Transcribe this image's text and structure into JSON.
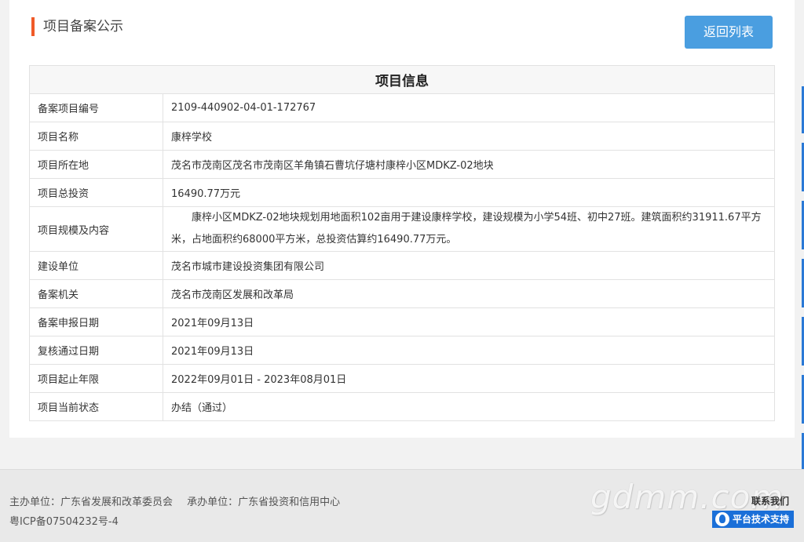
{
  "header": {
    "title": "项目备案公示",
    "back_label": "返回列表"
  },
  "table": {
    "title": "项目信息",
    "rows": [
      {
        "label": "备案项目编号",
        "value": "2109-440902-04-01-172767"
      },
      {
        "label": "项目名称",
        "value": "康梓学校"
      },
      {
        "label": "项目所在地",
        "value": "茂名市茂南区茂名市茂南区羊角镇石曹坑仔塘村康梓小区MDKZ-02地块"
      },
      {
        "label": "项目总投资",
        "value": "16490.77万元"
      },
      {
        "label": "项目规模及内容",
        "value": "康梓小区MDKZ-02地块规划用地面积102亩用于建设康梓学校，建设规模为小学54班、初中27班。建筑面积约31911.67平方米，占地面积约68000平方米，总投资估算约16490.77万元。"
      },
      {
        "label": "建设单位",
        "value": "茂名市城市建设投资集团有限公司"
      },
      {
        "label": "备案机关",
        "value": "茂名市茂南区发展和改革局"
      },
      {
        "label": "备案申报日期",
        "value": "2021年09月13日"
      },
      {
        "label": "复核通过日期",
        "value": "2021年09月13日"
      },
      {
        "label": "项目起止年限",
        "value": "2022年09月01日 - 2023年08月01日"
      },
      {
        "label": "项目当前状态",
        "value": "办结（通过）"
      }
    ]
  },
  "footer": {
    "sponsor": "主办单位：广东省发展和改革委员会",
    "organizer": "承办单位：广东省投资和信用中心",
    "icp": "粤ICP备07504232号-4",
    "watermark": "gdmm.com",
    "contact_title": "联系我们",
    "support_label": "平台技术支持"
  },
  "colors": {
    "accent_bar": "#f05a28",
    "button": "#4a9ee0",
    "support_button": "#1a6fd8",
    "side_strip": "#2a79d6"
  }
}
